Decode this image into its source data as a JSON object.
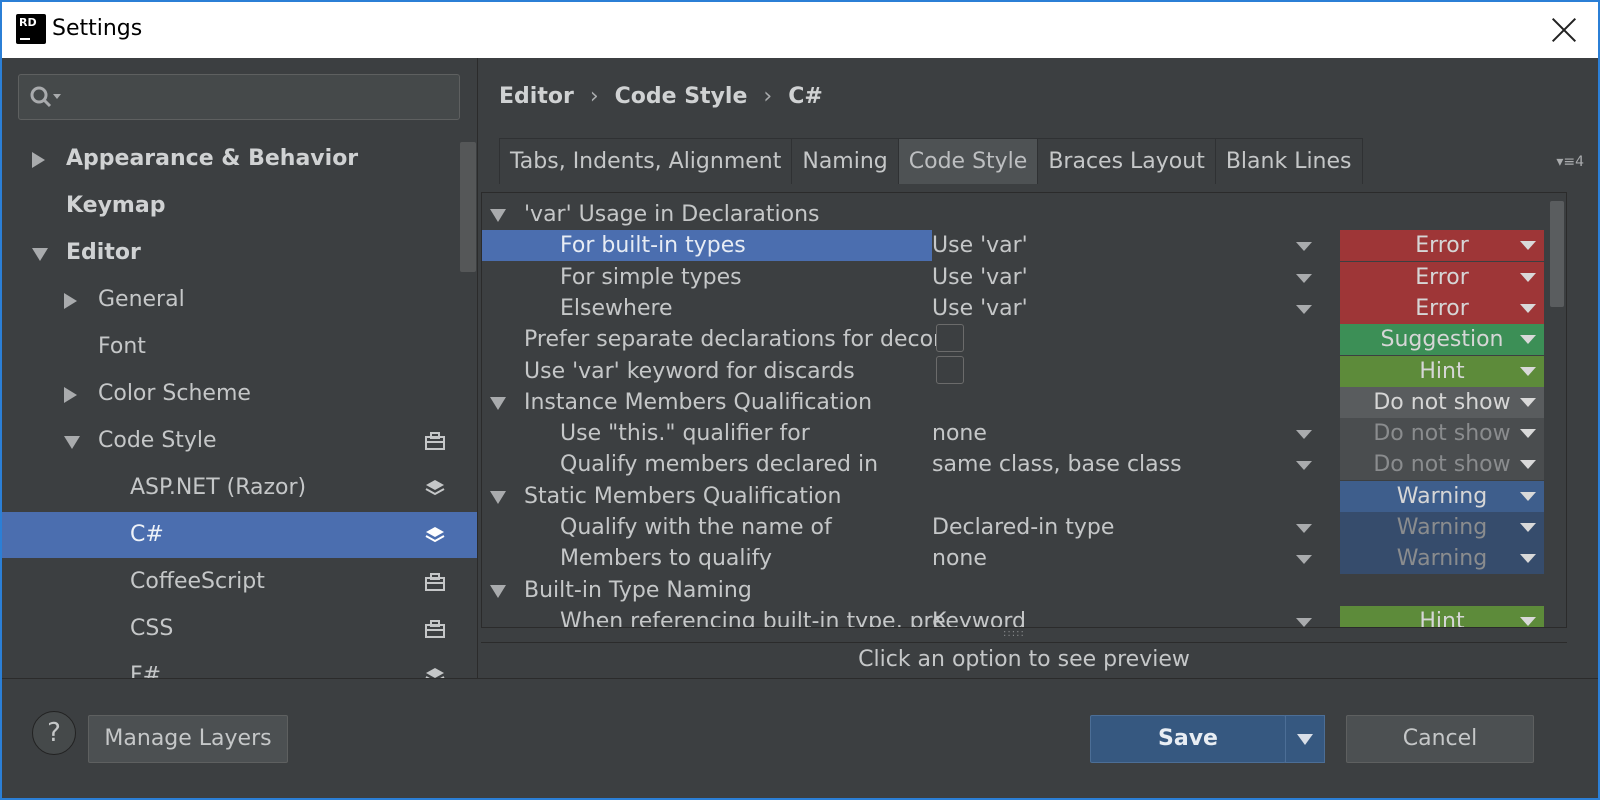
{
  "window": {
    "title": "Settings",
    "logo_text": "RD"
  },
  "sidebar": {
    "search": {
      "placeholder": ""
    },
    "items": [
      {
        "label": "Appearance & Behavior",
        "bold": true,
        "expand": "collapsed",
        "level": 0
      },
      {
        "label": "Keymap",
        "bold": true,
        "expand": "none",
        "level": 0
      },
      {
        "label": "Editor",
        "bold": true,
        "expand": "expanded",
        "level": 0
      },
      {
        "label": "General",
        "bold": false,
        "expand": "collapsed",
        "level": 1
      },
      {
        "label": "Font",
        "bold": false,
        "expand": "none",
        "level": 1
      },
      {
        "label": "Color Scheme",
        "bold": false,
        "expand": "collapsed",
        "level": 1
      },
      {
        "label": "Code Style",
        "bold": false,
        "expand": "expanded",
        "level": 1,
        "icon": "briefcase-icon"
      },
      {
        "label": "ASP.NET (Razor)",
        "bold": false,
        "expand": "none",
        "level": 2,
        "icon": "layers-icon"
      },
      {
        "label": "C#",
        "bold": false,
        "expand": "none",
        "level": 2,
        "icon": "layers-icon",
        "selected": true
      },
      {
        "label": "CoffeeScript",
        "bold": false,
        "expand": "none",
        "level": 2,
        "icon": "briefcase-icon"
      },
      {
        "label": "CSS",
        "bold": false,
        "expand": "none",
        "level": 2,
        "icon": "briefcase-icon"
      },
      {
        "label": "F#",
        "bold": false,
        "expand": "none",
        "level": 2,
        "icon": "layers-icon"
      }
    ]
  },
  "breadcrumb": [
    "Editor",
    "Code Style",
    "C#"
  ],
  "breadcrumb_sep": "›",
  "tabs": [
    {
      "label": "Tabs, Indents, Alignment",
      "active": false
    },
    {
      "label": "Naming",
      "active": false
    },
    {
      "label": "Code Style",
      "active": true
    },
    {
      "label": "Braces Layout",
      "active": false
    },
    {
      "label": "Blank Lines",
      "active": false
    }
  ],
  "tab_overflow": "▾≡4",
  "options": [
    {
      "kind": "group",
      "label": "'var' Usage in Declarations",
      "value": "",
      "severity": "",
      "sev_color": ""
    },
    {
      "kind": "item",
      "label": "For built-in types",
      "value": "Use 'var'",
      "severity": "Error",
      "sev_color": "#9e3637",
      "selected": true
    },
    {
      "kind": "item",
      "label": "For simple types",
      "value": "Use 'var'",
      "severity": "Error",
      "sev_color": "#9e3637"
    },
    {
      "kind": "item",
      "label": "Elsewhere",
      "value": "Use 'var'",
      "severity": "Error",
      "sev_color": "#9e3637"
    },
    {
      "kind": "check",
      "label": "Prefer separate declarations for decons",
      "value": "",
      "severity": "Suggestion",
      "sev_color": "#3c8f56"
    },
    {
      "kind": "check",
      "label": "Use 'var' keyword for discards",
      "value": "",
      "severity": "Hint",
      "sev_color": "#5d8b3a"
    },
    {
      "kind": "group",
      "label": "Instance Members Qualification",
      "value": "",
      "severity": "Do not show",
      "sev_color": "#595c5e"
    },
    {
      "kind": "item",
      "label": "Use \"this.\" qualifier for",
      "value": "none",
      "severity": "Do not show",
      "sev_color": "#4a4d4f",
      "dim": true
    },
    {
      "kind": "item",
      "label": "Qualify members declared in",
      "value": "same class, base class",
      "severity": "Do not show",
      "sev_color": "#4a4d4f",
      "dim": true
    },
    {
      "kind": "group",
      "label": "Static Members Qualification",
      "value": "",
      "severity": "Warning",
      "sev_color": "#3e5e8c"
    },
    {
      "kind": "item",
      "label": "Qualify with the name of",
      "value": "Declared-in type",
      "severity": "Warning",
      "sev_color": "#364c6c",
      "dim": true
    },
    {
      "kind": "item",
      "label": "Members to qualify",
      "value": "none",
      "severity": "Warning",
      "sev_color": "#364c6c",
      "dim": true
    },
    {
      "kind": "group",
      "label": "Built-in Type Naming",
      "value": "",
      "severity": "",
      "sev_color": ""
    },
    {
      "kind": "item",
      "label": "When referencing built-in type, pre",
      "value": "Keyword",
      "severity": "Hint",
      "sev_color": "#5d8b3a"
    }
  ],
  "preview_text": "Click an option to see preview",
  "footer": {
    "help": "?",
    "manage_layers": "Manage Layers",
    "save": "Save",
    "cancel": "Cancel"
  }
}
